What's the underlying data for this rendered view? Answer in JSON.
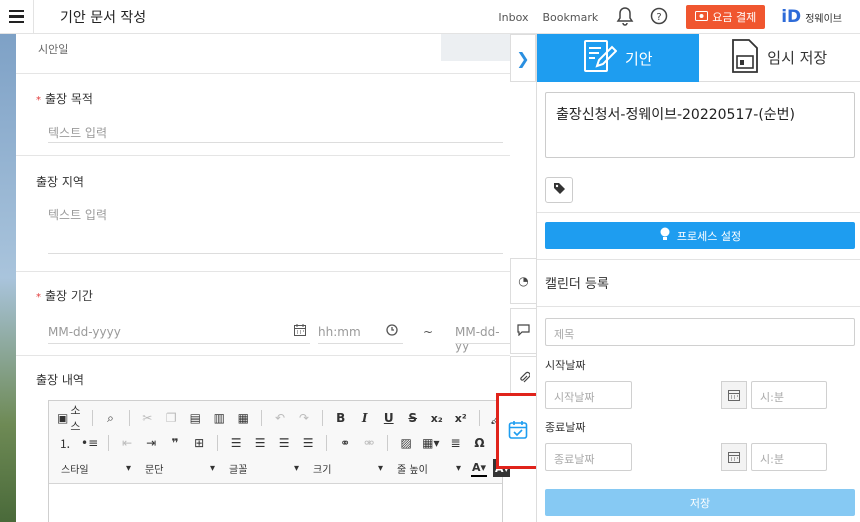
{
  "header": {
    "title": "기안 문서 작성",
    "links": [
      "Inbox",
      "Bookmark"
    ],
    "pay_label": "요금 결제",
    "brand_mark": "iD",
    "brand_name": "정웨이브"
  },
  "form": {
    "cut_label": "시안일",
    "purpose": {
      "label": "출장 목적",
      "placeholder": "텍스트 입력",
      "required": true
    },
    "region": {
      "label": "출장 지역",
      "placeholder": "텍스트 입력",
      "required": false
    },
    "period": {
      "label": "출장 기간",
      "date_placeholder": "MM-dd-yyyy",
      "time_placeholder": "hh:mm",
      "separator": "~",
      "date2_placeholder": "MM-dd-yy",
      "required": true
    },
    "details": {
      "label": "출장 내역",
      "required": false
    }
  },
  "editor": {
    "source_label": "소스",
    "dropdowns": [
      "스타일",
      "문단",
      "글꼴",
      "크기",
      "줄 높이"
    ]
  },
  "panel": {
    "tab_draft": "기안",
    "tab_temp_save": "임시 저장",
    "document_title": "출장신청서-정웨이브-20220517-(순번)",
    "process_button": "프로세스 설정",
    "calendar": {
      "title": "캘린더 등록",
      "title_placeholder": "제목",
      "start_label": "시작날짜",
      "start_placeholder": "시작날짜",
      "end_label": "종료날짜",
      "end_placeholder": "종료날짜",
      "time_placeholder": "시:분",
      "save_button": "저장"
    }
  },
  "colors": {
    "accent": "#1e9df0",
    "pay": "#f0562f",
    "highlight": "#e0231b"
  }
}
